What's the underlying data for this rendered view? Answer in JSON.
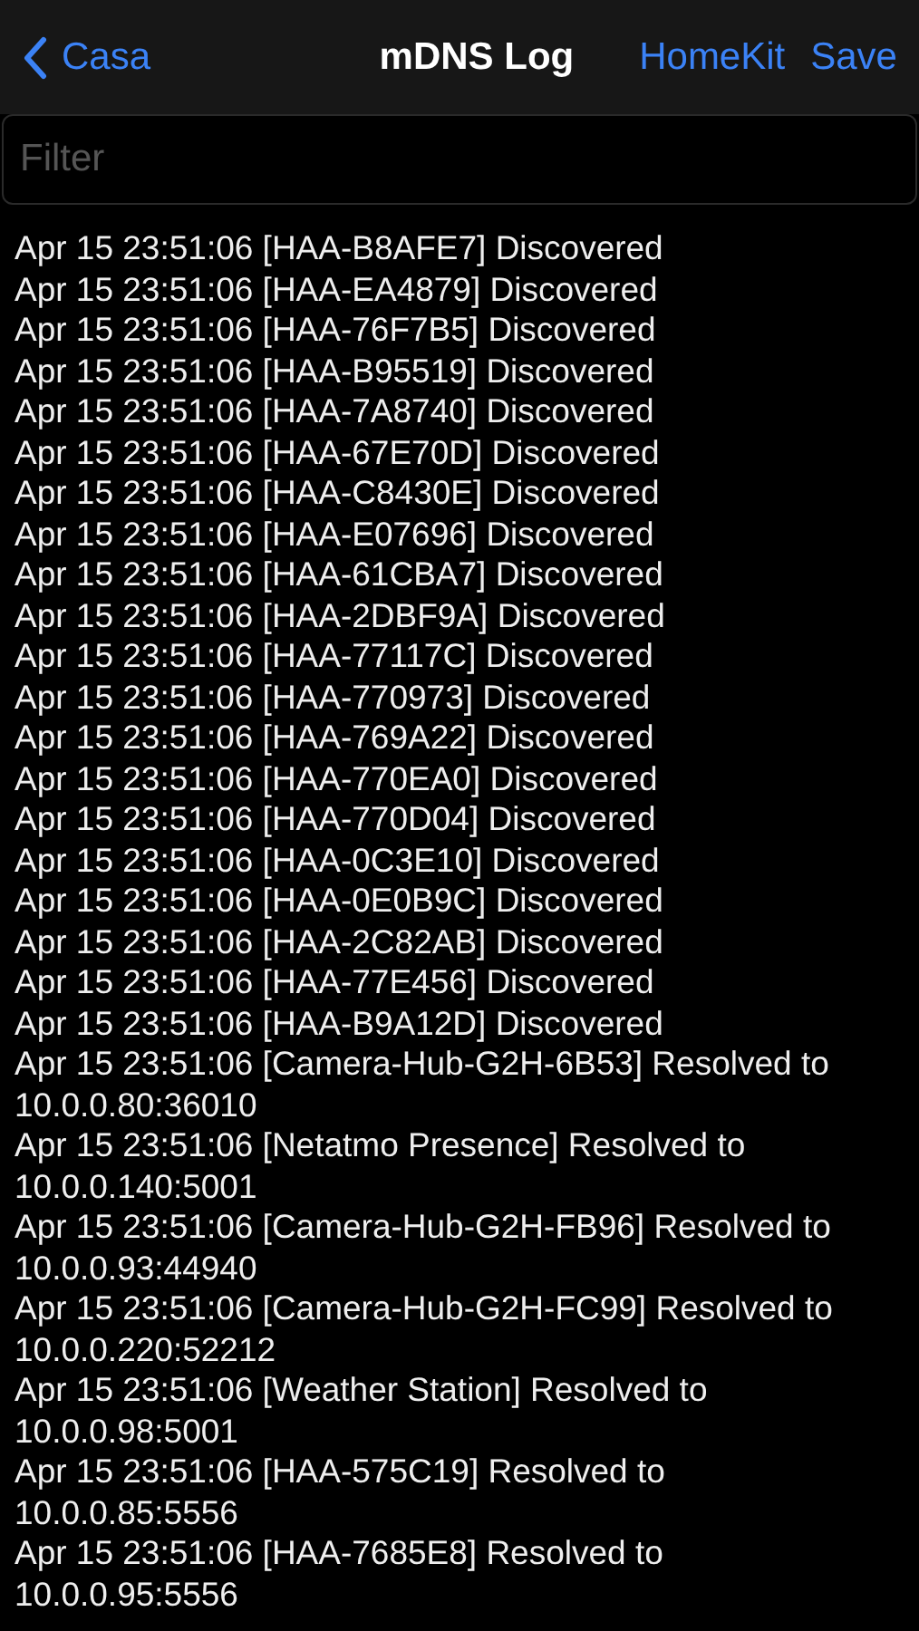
{
  "nav": {
    "back": "Casa",
    "title": "mDNS Log",
    "actions": [
      "HomeKit",
      "Save"
    ]
  },
  "filter": {
    "placeholder": "Filter"
  },
  "log": [
    {
      "text": "Apr 15 23:51:06 [HAA-B8AFE7] Discovered"
    },
    {
      "text": "Apr 15 23:51:06 [HAA-EA4879] Discovered"
    },
    {
      "text": "Apr 15 23:51:06 [HAA-76F7B5] Discovered"
    },
    {
      "text": "Apr 15 23:51:06 [HAA-B95519] Discovered"
    },
    {
      "text": "Apr 15 23:51:06 [HAA-7A8740] Discovered"
    },
    {
      "text": "Apr 15 23:51:06 [HAA-67E70D] Discovered"
    },
    {
      "text": "Apr 15 23:51:06 [HAA-C8430E] Discovered"
    },
    {
      "text": "Apr 15 23:51:06 [HAA-E07696] Discovered"
    },
    {
      "text": "Apr 15 23:51:06 [HAA-61CBA7] Discovered"
    },
    {
      "text": "Apr 15 23:51:06 [HAA-2DBF9A] Discovered"
    },
    {
      "text": "Apr 15 23:51:06 [HAA-77117C] Discovered"
    },
    {
      "text": "Apr 15 23:51:06 [HAA-770973] Discovered"
    },
    {
      "text": "Apr 15 23:51:06 [HAA-769A22] Discovered"
    },
    {
      "text": "Apr 15 23:51:06 [HAA-770EA0] Discovered"
    },
    {
      "text": "Apr 15 23:51:06 [HAA-770D04] Discovered"
    },
    {
      "text": "Apr 15 23:51:06 [HAA-0C3E10] Discovered"
    },
    {
      "text": "Apr 15 23:51:06 [HAA-0E0B9C] Discovered"
    },
    {
      "text": "Apr 15 23:51:06 [HAA-2C82AB] Discovered"
    },
    {
      "text": "Apr 15 23:51:06 [HAA-77E456] Discovered"
    },
    {
      "text": "Apr 15 23:51:06 [HAA-B9A12D] Discovered"
    },
    {
      "text": "Apr 15 23:51:06 [Camera-Hub-G2H-6B53] Resolved to",
      "address": "10.0.0.80:36010"
    },
    {
      "text": "Apr 15 23:51:06 [Netatmo Presence] Resolved to",
      "address": "10.0.0.140:5001"
    },
    {
      "text": "Apr 15 23:51:06 [Camera-Hub-G2H-FB96] Resolved to",
      "address": "10.0.0.93:44940"
    },
    {
      "text": "Apr 15 23:51:06 [Camera-Hub-G2H-FC99] Resolved to",
      "address": "10.0.0.220:52212"
    },
    {
      "text": "Apr 15 23:51:06 [Weather Station] Resolved to",
      "address": "10.0.0.98:5001"
    },
    {
      "text": "Apr 15 23:51:06 [HAA-575C19] Resolved to",
      "address": "10.0.0.85:5556"
    },
    {
      "text": "Apr 15 23:51:06 [HAA-7685E8] Resolved to",
      "address": "10.0.0.95:5556"
    }
  ]
}
